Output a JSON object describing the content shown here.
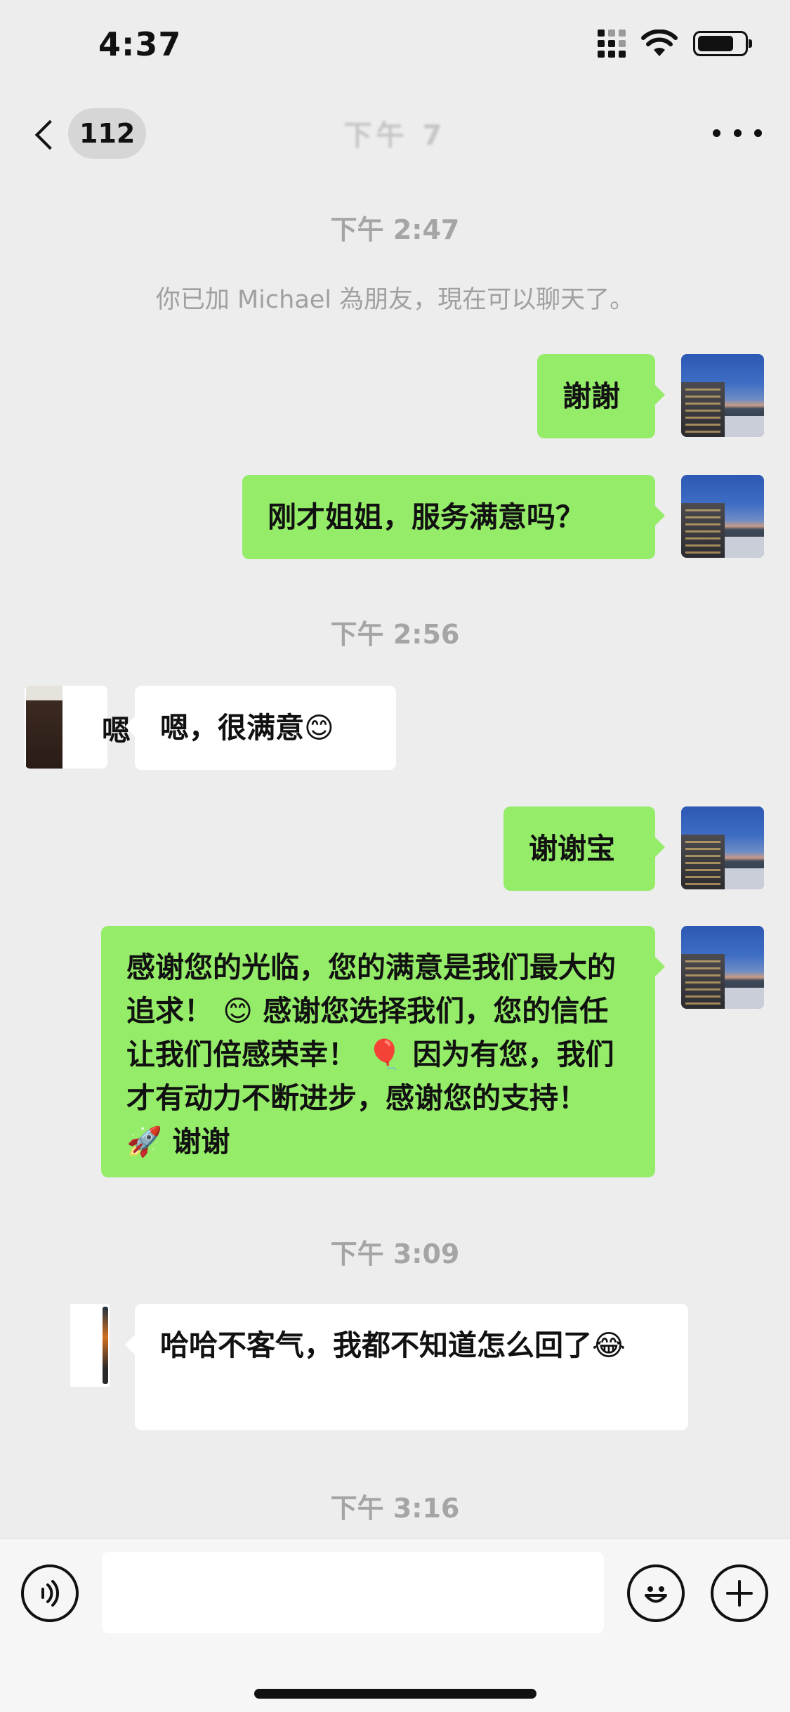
{
  "status_bar": {
    "time": "4:37"
  },
  "nav": {
    "back_badge": "112",
    "title": "下午 7"
  },
  "chat": {
    "timestamps": [
      "下午 2:47",
      "下午 2:56",
      "下午 3:09",
      "下午 3:16"
    ],
    "system_message": "你已加 Michael 為朋友，現在可以聊天了。",
    "messages": [
      {
        "side": "me",
        "text": "謝謝"
      },
      {
        "side": "me",
        "text": "刚才姐姐，服务满意吗？"
      },
      {
        "side": "other",
        "text": "嗯，很满意😊",
        "side_label": "嗯"
      },
      {
        "side": "me",
        "text": "谢谢宝"
      },
      {
        "side": "me",
        "text": "感谢您的光临，您的满意是我们最大的追求！ 😊 感谢您选择我们，您的信任让我们倍感荣幸！ 🎈 因为有您，我们才有动力不断进步，感谢您的支持！ 🚀 谢谢"
      },
      {
        "side": "other",
        "text": "哈哈不客气，我都不知道怎么回了😂"
      }
    ]
  },
  "input_bar": {
    "placeholder": ""
  },
  "icons": {
    "back": "chevron-left-icon",
    "more": "more-dots-icon",
    "voice": "voice-icon",
    "emoji": "emoji-icon",
    "plus": "plus-icon"
  },
  "colors": {
    "my_bubble": "#95ec69",
    "other_bubble": "#ffffff",
    "background": "#ededed"
  }
}
